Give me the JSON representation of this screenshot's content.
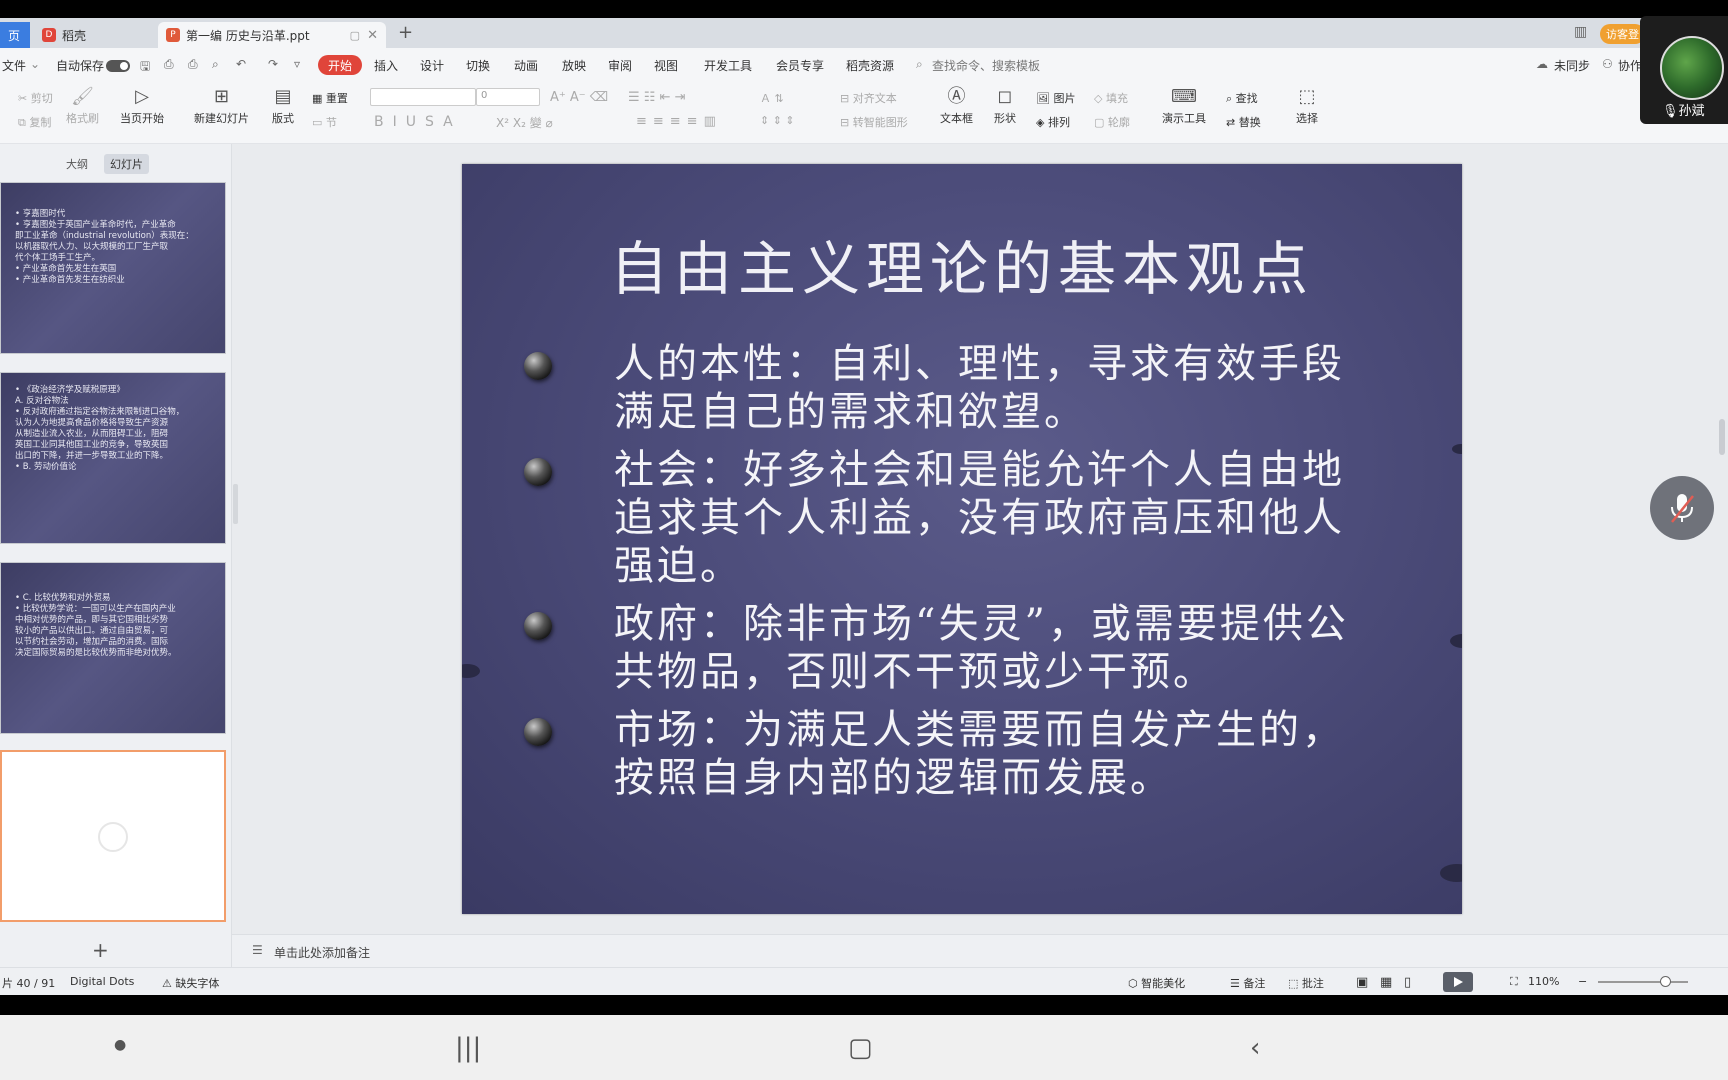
{
  "tabs": [
    {
      "label": "页",
      "icon": "home-icon"
    },
    {
      "label": "稻壳",
      "icon": "docer-icon"
    },
    {
      "label": "第一编 历史与沿革.ppt",
      "icon": "ppt-file-icon"
    }
  ],
  "menu": {
    "file": "文件",
    "autosave": "自动保存",
    "items": [
      "开始",
      "插入",
      "设计",
      "切换",
      "动画",
      "放映",
      "审阅",
      "视图",
      "开发工具",
      "会员专享",
      "稻壳资源"
    ],
    "active": "开始",
    "search_placeholder": "查找命令、搜索模板",
    "unsynced": "未同步",
    "collab": "协作",
    "guest": "访客登"
  },
  "toolbar": {
    "cut": "剪切",
    "copy": "复制",
    "format_painter": "格式刷",
    "from_current": "当页开始",
    "new_slide": "新建幻灯片",
    "layout": "版式",
    "reset": "重置",
    "section": "节",
    "font_size": "0",
    "align_text": "对齐文本",
    "smart_graphic": "转智能图形",
    "textbox": "文本框",
    "shape": "形状",
    "picture": "图片",
    "fill": "填充",
    "arrange": "排列",
    "outline": "轮廓",
    "presenter_tools": "演示工具",
    "find": "查找",
    "replace": "替换",
    "select": "选择"
  },
  "panel": {
    "outline_tab": "大纲",
    "slides_tab": "幻灯片",
    "thumbs": [
      {
        "lines": [
          "• 亨嘉图时代",
          "• 亨嘉图处于英国产业革命时代，产业革命",
          "  即工业革命（industrial revolution）表现在：",
          "  以机器取代人力、以大规模的工厂生产取",
          "  代个体工场手工生产。",
          "• 产业革命首先发生在英国",
          "• 产业革命首先发生在纺织业"
        ]
      },
      {
        "lines": [
          "• 《政治经济学及赋税原理》",
          "  A. 反对谷物法",
          "• 反对政府通过指定谷物法来限制进口谷物，",
          "  认为人为地提高食品价格将导致生产资源",
          "  从制造业流入农业，从而阻碍工业，阻碍",
          "  英国工业同其他国工业的竞争，导致英国",
          "  出口的下降，并进一步导致工业的下降。",
          "• B. 劳动价值论"
        ]
      },
      {
        "lines": [
          "• C. 比较优势和对外贸易",
          "• 比较优势学说：一国可以生产在国内产业",
          "  中相对优势的产品，即与其它国相比劣势",
          "  较小的产品以供出口。通过自由贸易，可",
          "  以节约社会劳动，增加产品的消费。国际",
          "  决定国际贸易的是比较优势而非绝对优势。"
        ]
      }
    ],
    "add": "+"
  },
  "slide": {
    "title": "自由主义理论的基本观点",
    "bullets": [
      "人的本性：自利、理性，寻求有效手段满足自己的需求和欲望。",
      "社会：好多社会和是能允许个人自由地追求其个人利益，没有政府高压和他人强迫。",
      "政府：除非市场“失灵”，或需要提供公共物品，否则不干预或少干预。",
      "市场：为满足人类需要而自发产生的，按照自身内部的逻辑而发展。"
    ]
  },
  "notes_placeholder": "单击此处添加备注",
  "status": {
    "slide_count": "片 40 / 91",
    "theme": "Digital Dots",
    "missing_font": "缺失字体",
    "beautify": "智能美化",
    "notes": "备注",
    "comments": "批注",
    "zoom": "110%"
  },
  "overlay": {
    "user_name": "孙斌"
  },
  "colors": {
    "accent": "#e0453a",
    "slide_bg": "#4c4c7a",
    "selected_thumb_border": "#f29d6a"
  }
}
